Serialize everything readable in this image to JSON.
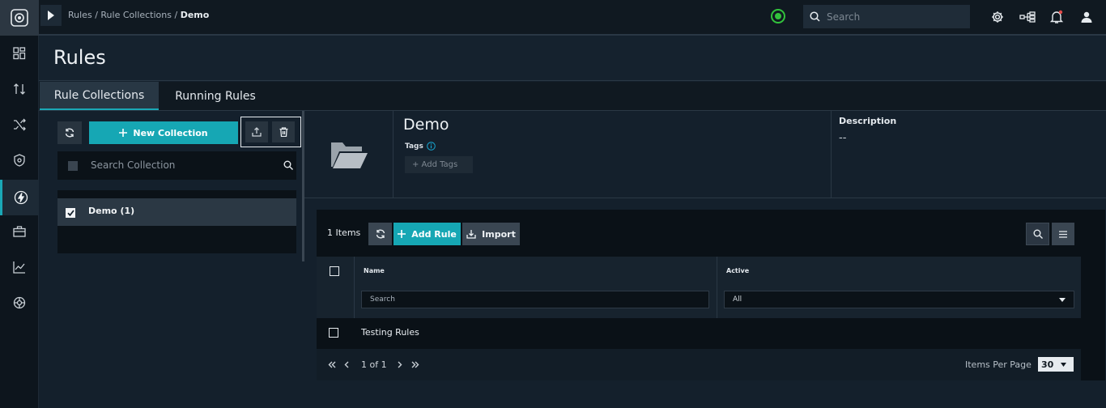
{
  "topbar": {
    "breadcrumb": {
      "items": [
        "Rules",
        "Rule Collections"
      ],
      "separator": "/",
      "current": "Demo"
    },
    "search_placeholder": "Search"
  },
  "page": {
    "title": "Rules"
  },
  "tabs": [
    {
      "label": "Rule Collections",
      "active": true
    },
    {
      "label": "Running Rules",
      "active": false
    }
  ],
  "collections_panel": {
    "new_button": "New Collection",
    "search_placeholder": "Search Collection",
    "items": [
      {
        "label": "Demo (1)",
        "checked": true,
        "selected": true
      }
    ]
  },
  "detail": {
    "name": "Demo",
    "tags_label": "Tags",
    "add_tags_label": "+ Add Tags",
    "description_label": "Description",
    "description_value": "--"
  },
  "rules_table": {
    "count_label": "1 Items",
    "add_button": "Add Rule",
    "import_button": "Import",
    "columns": {
      "name": "Name",
      "active": "Active"
    },
    "name_filter_placeholder": "Search",
    "active_filter_value": "All",
    "rows": [
      {
        "name": "Testing Rules"
      }
    ],
    "pagination": {
      "page_label": "1 of 1",
      "per_page_label": "Items Per Page",
      "per_page_value": "30"
    }
  },
  "colors": {
    "accent": "#16a7b4",
    "status_ok": "#32c23c"
  }
}
